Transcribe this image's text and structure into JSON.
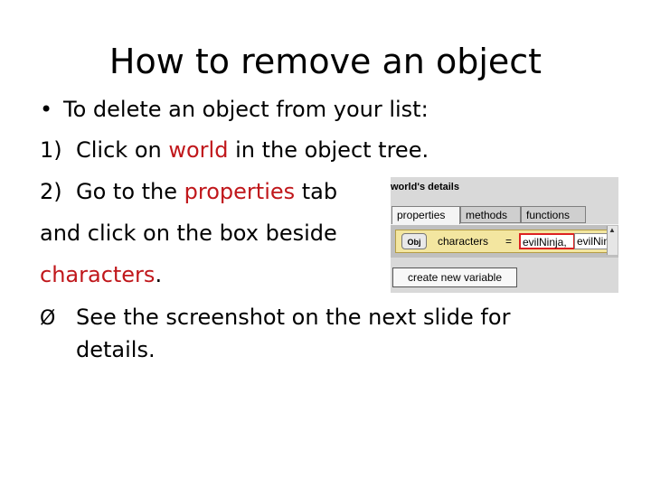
{
  "slide": {
    "title": "How to remove an object",
    "bullet_marker": "•",
    "bullet_text": "To delete an object from your list:",
    "step1": {
      "num": "1)",
      "pre": "Click on ",
      "hl": "world",
      "post": " in the object tree."
    },
    "step2": {
      "num": "2)",
      "pre": "Go to the ",
      "hl": "properties",
      "post": " tab"
    },
    "step2_line2": "and click on the box beside",
    "step2_line3": {
      "hl": "characters",
      "post": "."
    },
    "note": {
      "marker": "Ø",
      "line1": "See the screenshot on the next slide for",
      "line2": "details."
    },
    "colors": {
      "highlight": "#c0171b"
    }
  },
  "screenshot": {
    "title": "world's details",
    "tabs": [
      "properties",
      "methods",
      "functions"
    ],
    "active_tab": "properties",
    "property": {
      "icon_label": "Obj",
      "name": "characters",
      "equals": "=",
      "values": [
        "evilNinja,",
        "evilNin"
      ]
    },
    "button": "create new variable"
  }
}
